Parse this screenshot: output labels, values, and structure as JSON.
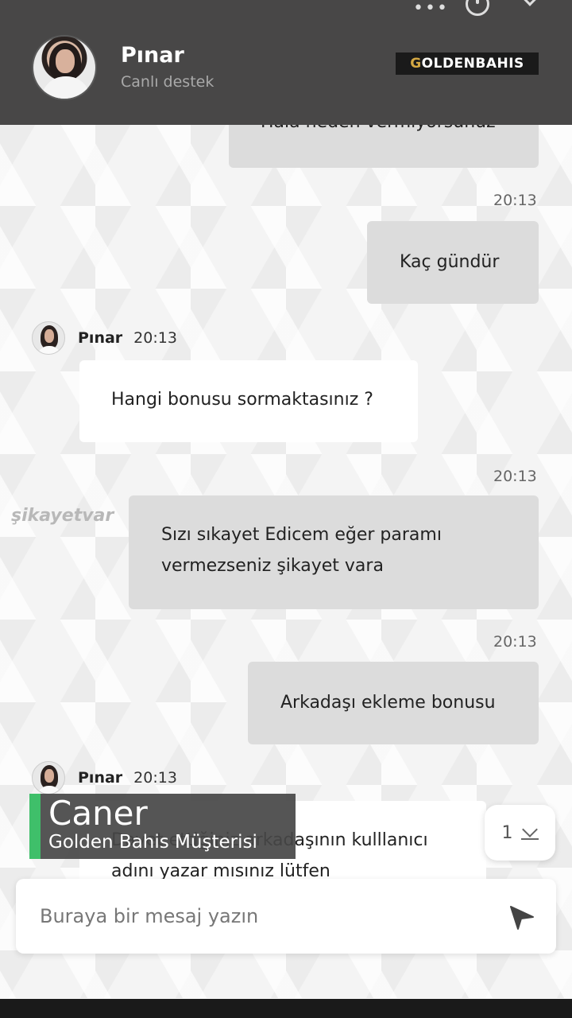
{
  "header": {
    "agent_name": "Pınar",
    "agent_status": "Canlı destek",
    "logo_prefix": "G",
    "logo_text": "OLDENBAHIS",
    "menu_icon": "more-dots-icon",
    "power_icon": "power-icon",
    "collapse_icon": "chevron-down-icon"
  },
  "messages": {
    "m0": {
      "text": "Hala neden vermiyorsunuz",
      "direction": "out"
    },
    "t1": "20:13",
    "m1": {
      "text": "Kaç gündür",
      "direction": "out"
    },
    "s2": {
      "name": "Pınar",
      "time": "20:13"
    },
    "m2": {
      "text": "Hangi bonusu sormaktasınız ?",
      "direction": "in"
    },
    "t3": "20:13",
    "m3": {
      "line1": "Sızı sıkayet Edicem eğer paramı",
      "line2": "vermezseniz şikayet vara",
      "direction": "out"
    },
    "t4": "20:13",
    "m4": {
      "text": "Arkadaşı ekleme bonusu",
      "direction": "out"
    },
    "s5": {
      "name": "Pınar",
      "time": "20:13"
    },
    "m5": {
      "line1": "Davet ettiğiniz arkadaşının kulllanıcı",
      "line2": "adını yazar mısınız lütfen",
      "direction": "in"
    }
  },
  "watermark": "şikayetvar",
  "caption": {
    "name": "Caner",
    "role": "Golden Bahis Müşterisi",
    "accent": "#3fbf6a"
  },
  "scroll_badge": {
    "count": "1"
  },
  "composer": {
    "placeholder": "Buraya bir mesaj yazın",
    "value": "",
    "send_icon": "send-icon"
  },
  "colors": {
    "header_bg": "#484747",
    "outgoing_bubble": "#dcdcdc",
    "incoming_bubble": "#ffffff",
    "logo_gold": "#d4a843"
  }
}
